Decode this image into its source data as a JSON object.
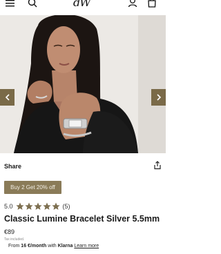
{
  "header": {
    "logo": "dW",
    "menu_icon": "hamburger-menu-icon",
    "search_icon": "search-icon",
    "account_icon": "user-icon",
    "bag_icon": "shopping-bag-icon"
  },
  "gallery": {
    "prev_icon": "chevron-left-icon",
    "next_icon": "chevron-right-icon"
  },
  "product": {
    "share_label": "Share",
    "promo_label": "Buy 2 Get 20% off",
    "rating_value": "5.0",
    "rating_count": "(5)",
    "stars_filled": 5,
    "title": "Classic Lumine Bracelet Silver 5.5mm",
    "price": "€89",
    "tax_note": "Tax included.",
    "klarna": {
      "prefix": "From",
      "amount": "16 €/month",
      "with": "with",
      "brand": "Klarna",
      "learn_more": "Learn more"
    }
  },
  "colors": {
    "accent": "#8a7b58",
    "arrow_bg": "#7a6a48",
    "star": "#7d6f50"
  }
}
